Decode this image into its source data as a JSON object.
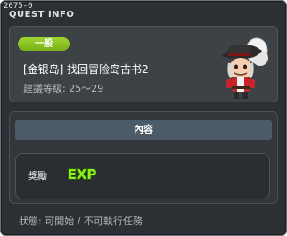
{
  "window": {
    "id_text": "2075-0",
    "title": "QUEST INFO"
  },
  "quest": {
    "category_badge": "一般",
    "name": "[金银岛] 找回冒险岛古书2",
    "recommended_level": "建議等级: 25～29",
    "npc": "npc-pirate-character"
  },
  "content": {
    "header": "內容",
    "reward_label": "獎勵",
    "reward_icon": "exp-icon",
    "reward_icon_text": "EXP"
  },
  "status": {
    "text": "狀態: 可開始 / 不可執行任務"
  },
  "colors": {
    "badge": "#8cc425",
    "header": "#4b5b68",
    "exp_green": "#8ef21c"
  }
}
